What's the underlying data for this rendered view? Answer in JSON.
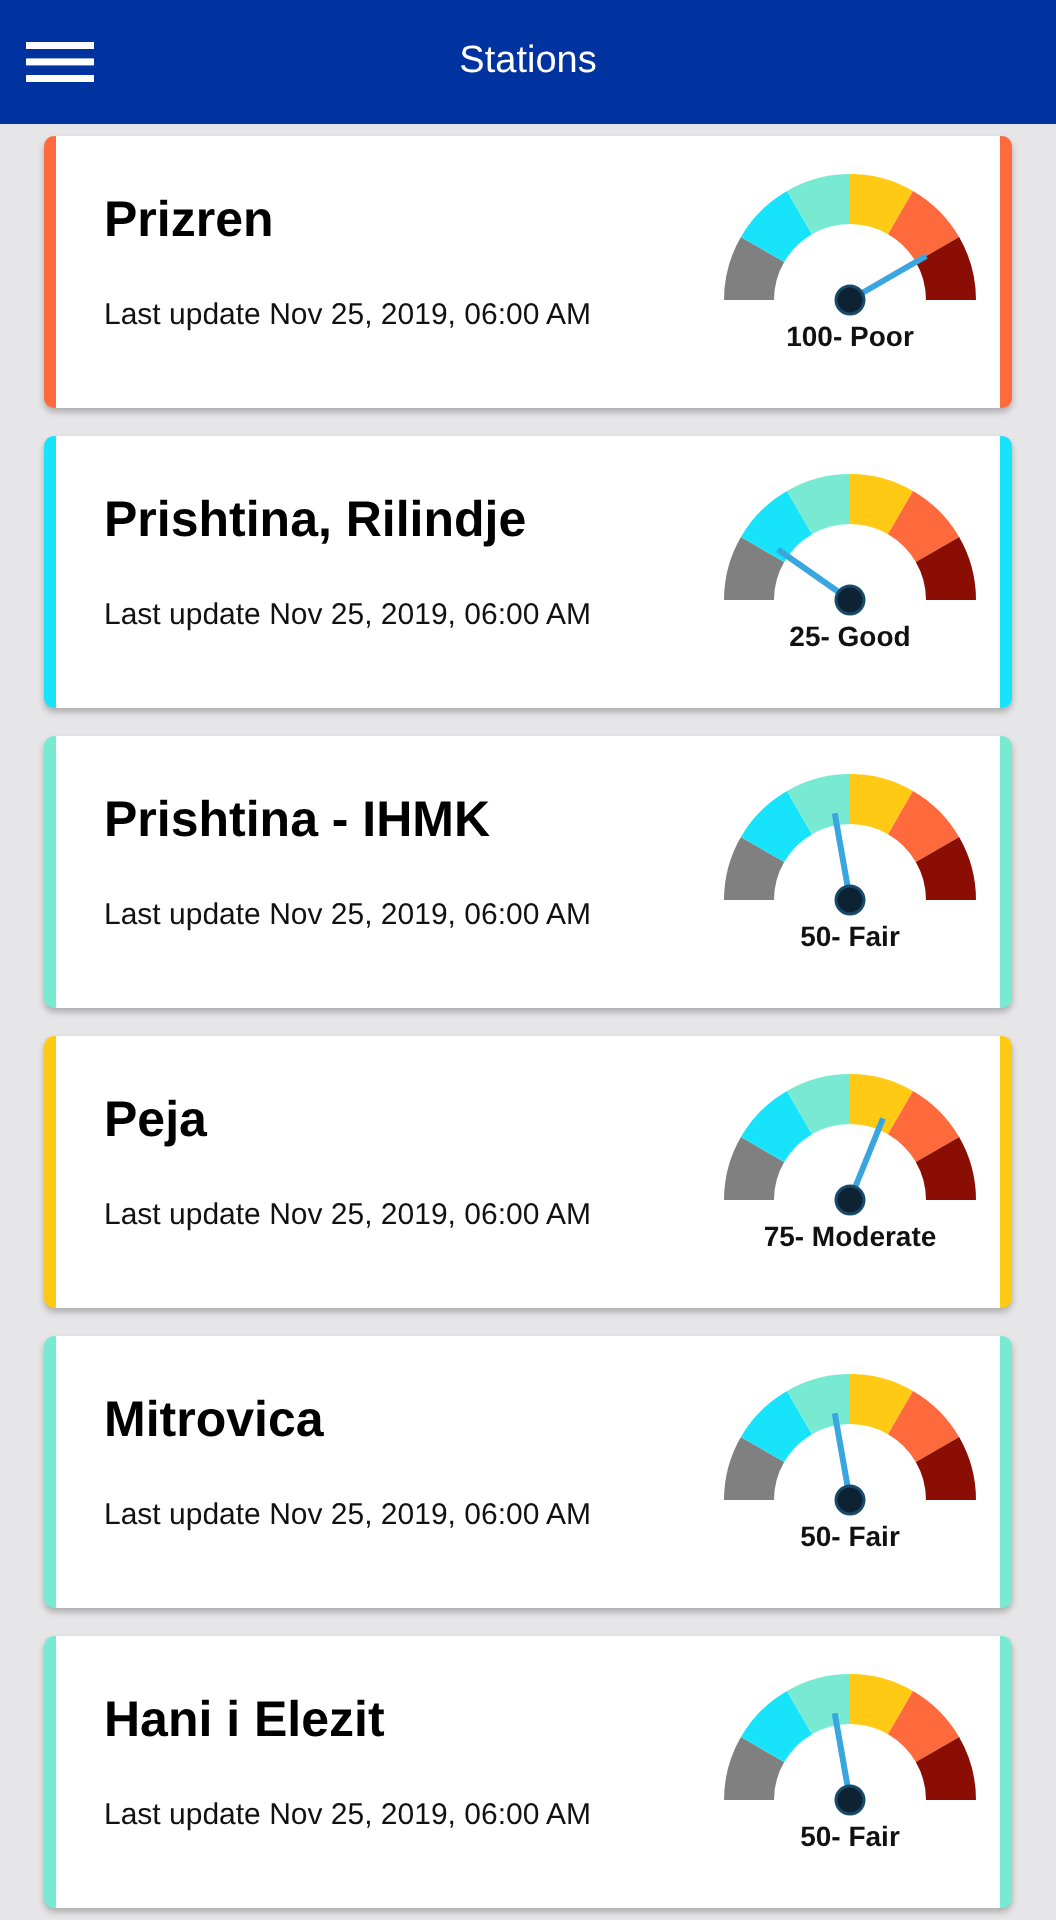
{
  "header": {
    "title": "Stations"
  },
  "stations": [
    {
      "name": "Prizren",
      "updated": "Last update Nov 25, 2019, 06:00 AM",
      "reading": "100- Poor",
      "color": "#ff6a3d"
    },
    {
      "name": "Prishtina, Rilindje",
      "updated": "Last update Nov 25, 2019, 06:00 AM",
      "reading": "25- Good",
      "color": "#17e4fb"
    },
    {
      "name": "Prishtina - IHMK",
      "updated": "Last update Nov 25, 2019, 06:00 AM",
      "reading": "50- Fair",
      "color": "#79ead2"
    },
    {
      "name": "Peja",
      "updated": "Last update Nov 25, 2019, 06:00 AM",
      "reading": "75- Moderate",
      "color": "#ffc914"
    },
    {
      "name": "Mitrovica",
      "updated": "Last update Nov 25, 2019, 06:00 AM",
      "reading": "50- Fair",
      "color": "#79ead2"
    },
    {
      "name": "Hani i Elezit",
      "updated": "Last update Nov 25, 2019, 06:00 AM",
      "reading": "50- Fair",
      "color": "#79ead2"
    }
  ]
}
